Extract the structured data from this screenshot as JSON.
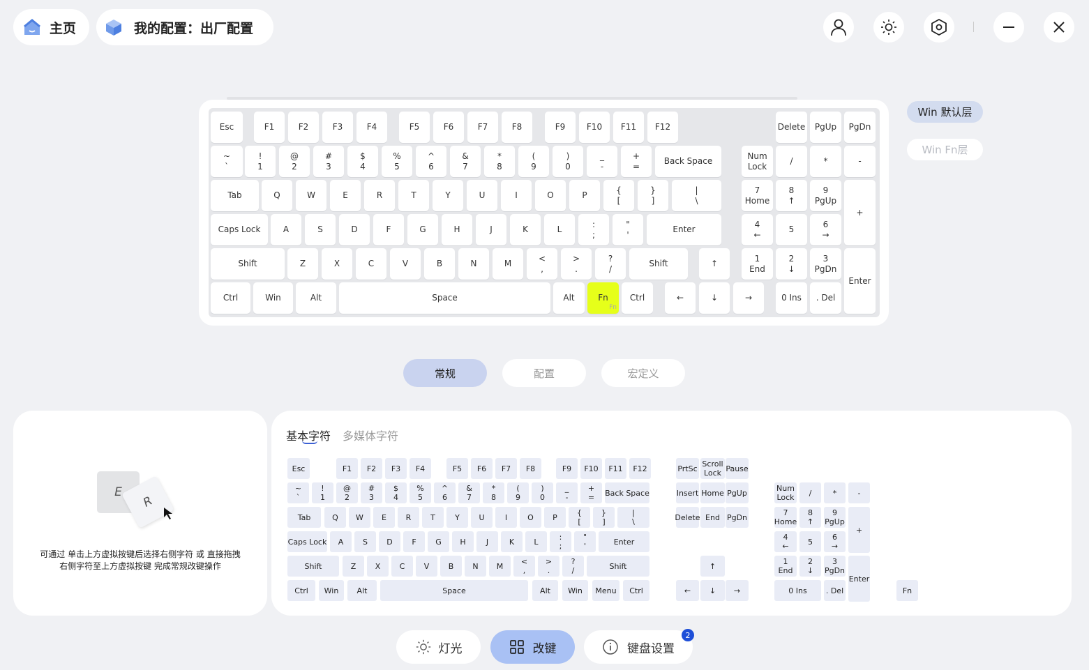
{
  "header": {
    "home": "主页",
    "config_title": "我的配置：出厂配置"
  },
  "layers": {
    "default": "Win 默认层",
    "fn": "Win Fn层"
  },
  "main_keys": [
    [
      "Esc",
      302,
      160,
      46
    ],
    [
      "F1",
      364,
      160,
      44
    ],
    [
      "F2",
      413,
      160,
      44
    ],
    [
      "F3",
      462,
      160,
      44
    ],
    [
      "F4",
      511,
      160,
      44
    ],
    [
      "F5",
      572,
      160,
      44
    ],
    [
      "F6",
      621,
      160,
      44
    ],
    [
      "F7",
      670,
      160,
      44
    ],
    [
      "F8",
      719,
      160,
      44
    ],
    [
      "F9",
      781,
      160,
      44
    ],
    [
      "F10",
      830,
      160,
      44
    ],
    [
      "F11",
      879,
      160,
      44
    ],
    [
      "F12",
      928,
      160,
      44
    ],
    [
      "~\n`",
      302,
      209,
      46
    ],
    [
      "!\n1",
      351,
      209,
      44
    ],
    [
      "@\n2",
      400,
      209,
      44
    ],
    [
      "#\n3",
      449,
      209,
      44
    ],
    [
      "$\n4",
      498,
      209,
      44
    ],
    [
      "%\n5",
      547,
      209,
      44
    ],
    [
      "^\n6",
      596,
      209,
      44
    ],
    [
      "&\n7",
      645,
      209,
      44
    ],
    [
      "*\n8",
      694,
      209,
      44
    ],
    [
      "(\n9",
      743,
      209,
      44
    ],
    [
      ")\n0",
      792,
      209,
      44
    ],
    [
      "_\n-",
      841,
      209,
      44
    ],
    [
      "+\n=",
      890,
      209,
      44
    ],
    [
      "Back Space",
      939,
      209,
      95
    ],
    [
      "Tab",
      302,
      258,
      69
    ],
    [
      "Q",
      375,
      258,
      44
    ],
    [
      "W",
      424,
      258,
      44
    ],
    [
      "E",
      473,
      258,
      44
    ],
    [
      "R",
      522,
      258,
      44
    ],
    [
      "T",
      571,
      258,
      44
    ],
    [
      "Y",
      620,
      258,
      44
    ],
    [
      "U",
      669,
      258,
      44
    ],
    [
      "I",
      718,
      258,
      44
    ],
    [
      "O",
      767,
      258,
      44
    ],
    [
      "P",
      816,
      258,
      44
    ],
    [
      "{\n[",
      865,
      258,
      44
    ],
    [
      "}\n]",
      914,
      258,
      44
    ],
    [
      "|\n\\",
      963,
      258,
      71
    ],
    [
      "Caps Lock",
      302,
      307,
      82
    ],
    [
      "A",
      388,
      307,
      44
    ],
    [
      "S",
      437,
      307,
      44
    ],
    [
      "D",
      486,
      307,
      44
    ],
    [
      "F",
      535,
      307,
      44
    ],
    [
      "G",
      584,
      307,
      44
    ],
    [
      "H",
      633,
      307,
      44
    ],
    [
      "J",
      682,
      307,
      44
    ],
    [
      "K",
      731,
      307,
      44
    ],
    [
      "L",
      780,
      307,
      44
    ],
    [
      ":\n;",
      829,
      307,
      44
    ],
    [
      "\"\n'",
      878,
      307,
      44
    ],
    [
      "Enter",
      927,
      307,
      107
    ],
    [
      "Shift",
      302,
      356,
      106
    ],
    [
      "Z",
      412,
      356,
      44
    ],
    [
      "X",
      461,
      356,
      44
    ],
    [
      "C",
      510,
      356,
      44
    ],
    [
      "V",
      559,
      356,
      44
    ],
    [
      "B",
      608,
      356,
      44
    ],
    [
      "N",
      657,
      356,
      44
    ],
    [
      "M",
      706,
      356,
      44
    ],
    [
      "<\n,",
      755,
      356,
      44
    ],
    [
      ">\n.",
      804,
      356,
      44
    ],
    [
      "?\n/",
      853,
      356,
      44
    ],
    [
      "Shift",
      902,
      356,
      84
    ],
    [
      "↑",
      1002,
      356,
      44
    ],
    [
      "Ctrl",
      302,
      405,
      57
    ],
    [
      "Win",
      363,
      405,
      57
    ],
    [
      "Alt",
      424,
      405,
      58
    ],
    [
      "Space",
      486,
      405,
      303
    ],
    [
      "Alt",
      793,
      405,
      45
    ],
    [
      "Fn",
      842,
      405,
      45
    ],
    [
      "Ctrl",
      891,
      405,
      45
    ],
    [
      "←",
      953,
      405,
      44
    ],
    [
      "↓",
      1002,
      405,
      44
    ],
    [
      "→",
      1051,
      405,
      44
    ],
    [
      "Delete",
      1112,
      160,
      45
    ],
    [
      "PgUp",
      1161,
      160,
      45
    ],
    [
      "PgDn",
      1210,
      160,
      45
    ],
    [
      "Num\nLock",
      1063,
      209,
      45
    ],
    [
      "/",
      1112,
      209,
      45
    ],
    [
      "*",
      1161,
      209,
      45
    ],
    [
      "-",
      1210,
      209,
      45
    ],
    [
      "7\nHome",
      1063,
      258,
      45
    ],
    [
      "8\n↑",
      1112,
      258,
      45
    ],
    [
      "9\nPgUp",
      1161,
      258,
      45
    ],
    [
      "4\n←",
      1063,
      307,
      45
    ],
    [
      "5",
      1112,
      307,
      45
    ],
    [
      "6\n→",
      1161,
      307,
      45
    ],
    [
      "1\nEnd",
      1063,
      356,
      45
    ],
    [
      "2\n↓",
      1112,
      356,
      45
    ],
    [
      "3\nPgDn",
      1161,
      356,
      45
    ],
    [
      "0 Ins",
      1112,
      405,
      45
    ],
    [
      ". Del",
      1161,
      405,
      45
    ]
  ],
  "fn_sublabel": "Fn",
  "tabs": {
    "normal": "常规",
    "config": "配置",
    "macro": "宏定义"
  },
  "hint": {
    "key_e": "E",
    "key_r": "R",
    "line1": "可通过 单击上方虚拟按键后选择右侧字符 或 直接拖拽",
    "line2": "右侧字符至上方虚拟按键 完成常规改键操作"
  },
  "char_tabs": {
    "basic": "基本字符",
    "media": "多媒体字符"
  },
  "char_keys": [
    [
      "Esc",
      412,
      657,
      32
    ],
    [
      "F1",
      482,
      657,
      31
    ],
    [
      "F2",
      517,
      657,
      31
    ],
    [
      "F3",
      552,
      657,
      31
    ],
    [
      "F4",
      587,
      657,
      31
    ],
    [
      "F5",
      640,
      657,
      31
    ],
    [
      "F6",
      675,
      657,
      31
    ],
    [
      "F7",
      710,
      657,
      31
    ],
    [
      "F8",
      745,
      657,
      31
    ],
    [
      "F9",
      797,
      657,
      31
    ],
    [
      "F10",
      832,
      657,
      31
    ],
    [
      "F11",
      867,
      657,
      31
    ],
    [
      "F12",
      902,
      657,
      31
    ],
    [
      "~\n`",
      412,
      692,
      31
    ],
    [
      "!\n1",
      447,
      692,
      31
    ],
    [
      "@\n2",
      482,
      692,
      31
    ],
    [
      "#\n3",
      517,
      692,
      31
    ],
    [
      "$\n4",
      552,
      692,
      31
    ],
    [
      "%\n5",
      587,
      692,
      31
    ],
    [
      "^\n6",
      622,
      692,
      31
    ],
    [
      "&\n7",
      657,
      692,
      31
    ],
    [
      "*\n8",
      692,
      692,
      31
    ],
    [
      "(\n9",
      727,
      692,
      31
    ],
    [
      ")\n0",
      762,
      692,
      31
    ],
    [
      "_\n-",
      797,
      692,
      31
    ],
    [
      "+\n=",
      832,
      692,
      31
    ],
    [
      "Back Space",
      867,
      692,
      64
    ],
    [
      "Tab",
      412,
      727,
      48
    ],
    [
      "Q",
      465,
      727,
      31
    ],
    [
      "W",
      500,
      727,
      31
    ],
    [
      "E",
      535,
      727,
      31
    ],
    [
      "R",
      570,
      727,
      31
    ],
    [
      "T",
      605,
      727,
      31
    ],
    [
      "Y",
      640,
      727,
      31
    ],
    [
      "U",
      675,
      727,
      31
    ],
    [
      "I",
      710,
      727,
      31
    ],
    [
      "O",
      745,
      727,
      31
    ],
    [
      "P",
      780,
      727,
      31
    ],
    [
      "{\n[",
      815,
      727,
      31
    ],
    [
      "}\n]",
      850,
      727,
      31
    ],
    [
      "|\n\\",
      885,
      727,
      46
    ],
    [
      "Caps Lock",
      412,
      762,
      57
    ],
    [
      "A",
      473,
      762,
      31
    ],
    [
      "S",
      508,
      762,
      31
    ],
    [
      "D",
      543,
      762,
      31
    ],
    [
      "F",
      578,
      762,
      31
    ],
    [
      "G",
      613,
      762,
      31
    ],
    [
      "H",
      648,
      762,
      31
    ],
    [
      "J",
      683,
      762,
      31
    ],
    [
      "K",
      718,
      762,
      31
    ],
    [
      "L",
      753,
      762,
      31
    ],
    [
      ":\n;",
      788,
      762,
      31
    ],
    [
      "\"\n'",
      823,
      762,
      31
    ],
    [
      "Enter",
      858,
      762,
      73
    ],
    [
      "Shift",
      412,
      797,
      74
    ],
    [
      "Z",
      491,
      797,
      31
    ],
    [
      "X",
      526,
      797,
      31
    ],
    [
      "C",
      561,
      797,
      31
    ],
    [
      "V",
      596,
      797,
      31
    ],
    [
      "B",
      631,
      797,
      31
    ],
    [
      "N",
      666,
      797,
      31
    ],
    [
      "M",
      701,
      797,
      31
    ],
    [
      "<\n,",
      736,
      797,
      31
    ],
    [
      ">\n.",
      771,
      797,
      31
    ],
    [
      "?\n/",
      806,
      797,
      31
    ],
    [
      "Shift",
      841,
      797,
      90
    ],
    [
      "Ctrl",
      412,
      832,
      40
    ],
    [
      "Win",
      457,
      832,
      36
    ],
    [
      "Alt",
      498,
      832,
      42
    ],
    [
      "Space",
      545,
      832,
      212
    ],
    [
      "Alt",
      763,
      832,
      37
    ],
    [
      "Win",
      806,
      832,
      37
    ],
    [
      "Menu",
      849,
      832,
      39
    ],
    [
      "Ctrl",
      893,
      832,
      38
    ],
    [
      "PrtSc",
      969,
      657,
      33
    ],
    [
      "Scroll\nLock",
      1004,
      657,
      35
    ],
    [
      "Pause",
      1040,
      657,
      33
    ],
    [
      "Insert",
      969,
      692,
      33
    ],
    [
      "Home",
      1004,
      692,
      35
    ],
    [
      "PgUp",
      1040,
      692,
      33
    ],
    [
      "Delete",
      969,
      727,
      33
    ],
    [
      "End",
      1004,
      727,
      35
    ],
    [
      "PgDn",
      1040,
      727,
      33
    ],
    [
      "↑",
      1004,
      797,
      35
    ],
    [
      "←",
      969,
      832,
      33
    ],
    [
      "↓",
      1004,
      832,
      35
    ],
    [
      "→",
      1040,
      832,
      33
    ],
    [
      "Num\nLock",
      1110,
      692,
      32
    ],
    [
      "/",
      1146,
      692,
      31
    ],
    [
      "*",
      1181,
      692,
      31
    ],
    [
      "-",
      1216,
      692,
      31
    ],
    [
      "7\nHome",
      1110,
      727,
      32
    ],
    [
      "8\n↑",
      1146,
      727,
      31
    ],
    [
      "9\nPgUp",
      1181,
      727,
      31
    ],
    [
      "4\n←",
      1110,
      762,
      32
    ],
    [
      "5",
      1146,
      762,
      31
    ],
    [
      "6\n→",
      1181,
      762,
      31
    ],
    [
      "1\nEnd",
      1110,
      797,
      32
    ],
    [
      "2\n↓",
      1146,
      797,
      31
    ],
    [
      "3\nPgDn",
      1181,
      797,
      31
    ],
    [
      "0 Ins",
      1110,
      832,
      67
    ],
    [
      ". Del",
      1181,
      832,
      31
    ],
    [
      "Fn",
      1285,
      832,
      31
    ]
  ],
  "char_tall": [
    [
      "+",
      1216,
      727,
      31,
      66
    ],
    [
      "Enter",
      1216,
      797,
      31,
      66
    ]
  ],
  "nav": {
    "light": "灯光",
    "remap": "改键",
    "settings": "键盘设置",
    "badge": "2"
  },
  "colors": {
    "accent": "#c4d2f5",
    "fn_highlight": "#e6ff1a",
    "badge": "#1e4fd8"
  }
}
